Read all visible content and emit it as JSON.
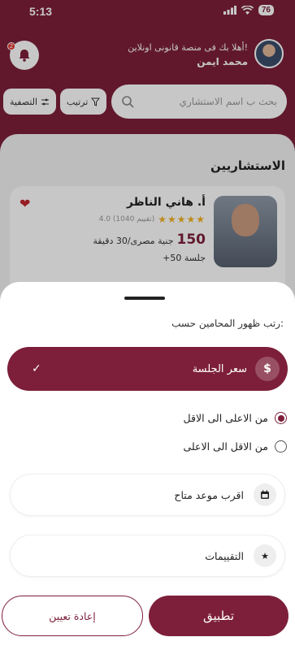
{
  "status": {
    "time": "5:13",
    "battery": "76"
  },
  "header": {
    "greeting": "أهلا بك فى منصة قانونى اونلاين!",
    "user_name": "محمد ايمن",
    "notification_count": "2"
  },
  "search": {
    "placeholder": "بحث ب اسم الاستشاري"
  },
  "toolbar": {
    "sort_label": "ترتيب",
    "filter_label": "التصفية"
  },
  "section_title": "الاستشاريين",
  "lawyer_card": {
    "name": "أ. هاني الناظر",
    "stars": "★★★★★",
    "rating_text": "4.0 (1040 تقييم)",
    "price_value": "150",
    "price_unit": "جنية مصرى/30 دقيقة",
    "sessions": "+50 جلسة"
  },
  "sheet": {
    "title": "رتب ظهور المحامين حسب:",
    "selected_option": {
      "label": "سعر الجلسة",
      "icon": "dollar-icon",
      "check": "✓"
    },
    "radio_options": [
      {
        "label": "من الاعلى الى الاقل",
        "selected": true
      },
      {
        "label": "من الاقل الى الاعلى",
        "selected": false
      }
    ],
    "options": [
      {
        "label": "اقرب موعد متاح",
        "icon": "calendar-icon"
      },
      {
        "label": "التقييمات",
        "icon": "star-icon"
      }
    ],
    "apply_label": "تطبيق",
    "reset_label": "إعادة تعيين"
  },
  "colors": {
    "primary": "#7d1f3a",
    "star": "#f3b323",
    "heart": "#c1272d"
  }
}
